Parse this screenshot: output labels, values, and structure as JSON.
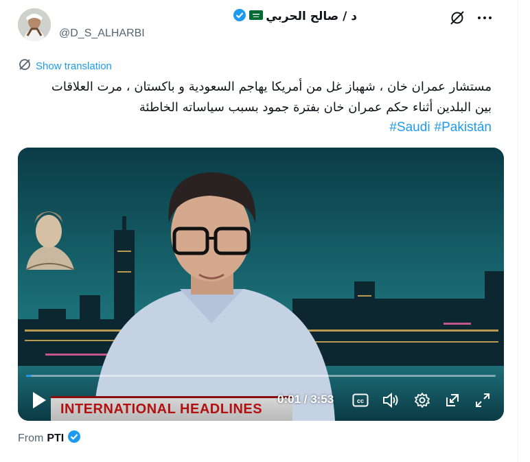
{
  "author": {
    "display_name": "د / صالح الحربي",
    "handle": "@D_S_ALHARBI",
    "flag_icon": "saudi-flag-icon",
    "verified_color": "#1d9bf0"
  },
  "header_actions": {
    "grok_icon": "grok-icon",
    "more_icon": "more-icon"
  },
  "translation": {
    "label": "Show translation"
  },
  "tweet": {
    "line1": "مستشار عمران خان ، شهباز غل من أمريكا يهاجم السعودية و باكستان ، مرت العلاقات",
    "line2": "بين البلدين أثناء حكم عمران خان بفترة جمود بسبب سياساته الخاطئة",
    "hashtags": [
      "#Saudi",
      "#Pakistán"
    ]
  },
  "video": {
    "time_label": "0:01 / 3:53",
    "progress": 0.004,
    "banner_text": "INTERNATIONAL HEADLINES",
    "controls": [
      "play-icon",
      "captions-icon",
      "volume-icon",
      "settings-icon",
      "popout-icon",
      "fullscreen-icon"
    ]
  },
  "source": {
    "from_label": "From",
    "from_name": "PTI"
  },
  "colors": {
    "accent": "#1d9bf0",
    "text": "#0f1419",
    "secondary": "#536471",
    "banner_red": "#b31010"
  }
}
